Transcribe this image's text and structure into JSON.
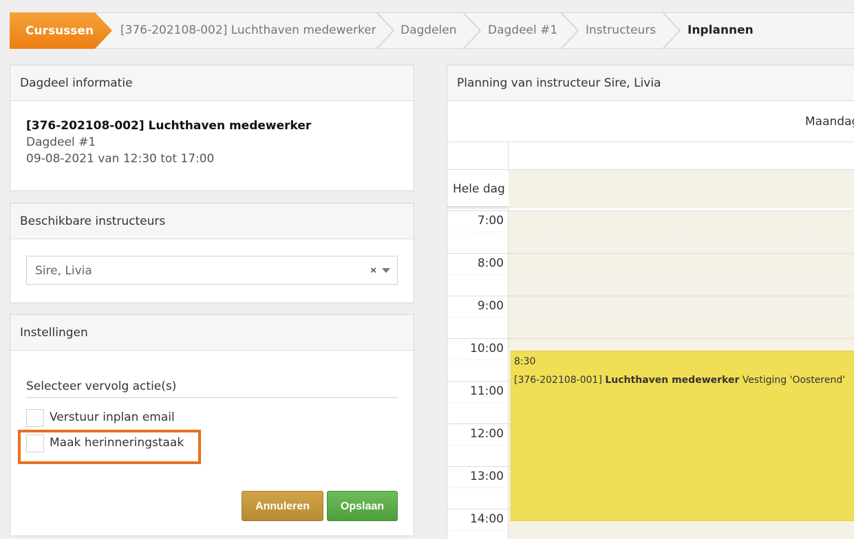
{
  "breadcrumb": {
    "items": [
      {
        "label": "Cursussen"
      },
      {
        "label": "[376-202108-002] Luchthaven medewerker"
      },
      {
        "label": "Dagdelen"
      },
      {
        "label": "Dagdeel #1"
      },
      {
        "label": "Instructeurs"
      },
      {
        "label": "Inplannen"
      }
    ],
    "accent": "#f08c1e"
  },
  "info_panel": {
    "title": "Dagdeel informatie",
    "course": "[376-202108-002] Luchthaven medewerker",
    "part": "Dagdeel #1",
    "when": "09-08-2021 van 12:30 tot 17:00"
  },
  "instructors_panel": {
    "title": "Beschikbare instructeurs",
    "selected": "Sire, Livia",
    "clear_glyph": "×"
  },
  "settings_panel": {
    "title": "Instellingen",
    "section_label": "Selecteer vervolg actie(s)",
    "options": [
      {
        "label": "Verstuur inplan email",
        "checked": false
      },
      {
        "label": "Maak herinneringstaak",
        "checked": false
      }
    ],
    "highlight_color": "#e8701f",
    "cancel_label": "Annuleren",
    "save_label": "Opslaan"
  },
  "calendar": {
    "title": "Planning van instructeur Sire, Livia",
    "day_name": "Maandag",
    "allday_label": "Hele dag",
    "hours": [
      "7:00",
      "8:00",
      "9:00",
      "10:00",
      "11:00",
      "12:00",
      "13:00",
      "14:00"
    ],
    "event": {
      "time": "8:30",
      "code": "[376-202108-001]",
      "name": "Luchthaven medewerker",
      "location": "Vestiging 'Oosterend'",
      "color": "#f0de55"
    }
  }
}
